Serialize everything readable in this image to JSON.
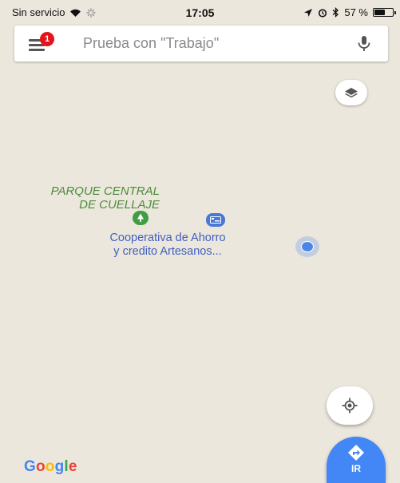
{
  "status_bar": {
    "carrier": "Sin servicio",
    "time": "17:05",
    "battery_percent": "57 %",
    "battery_level": 0.57
  },
  "search": {
    "placeholder": "Prueba con \"Trabajo\"",
    "menu_badge_count": "1"
  },
  "map": {
    "park_label_line1": "PARQUE CENTRAL",
    "park_label_line2": "DE CUELLAJE",
    "poi_label_line1": "Cooperativa de Ahorro",
    "poi_label_line2": "y credito Artesanos..."
  },
  "footer": {
    "google_logo": [
      "G",
      "o",
      "o",
      "g",
      "l",
      "e"
    ],
    "directions_label": "IR"
  },
  "colors": {
    "map_background": "#ece7dd",
    "badge_red": "#e4141b",
    "park_green": "#4c8c3a",
    "poi_blue": "#3f5fbf",
    "directions_blue": "#4287f5"
  },
  "icons": {
    "wifi": "wifi-icon",
    "activity": "activity-icon",
    "location_arrow": "location-arrow-icon",
    "alarm": "alarm-icon",
    "bluetooth": "bluetooth-icon",
    "battery": "battery-icon",
    "menu": "menu-icon",
    "mic": "mic-icon",
    "layers": "layers-icon",
    "park": "park-tree-icon",
    "atm": "atm-icon",
    "recenter": "my-location-icon",
    "directions": "directions-icon"
  }
}
